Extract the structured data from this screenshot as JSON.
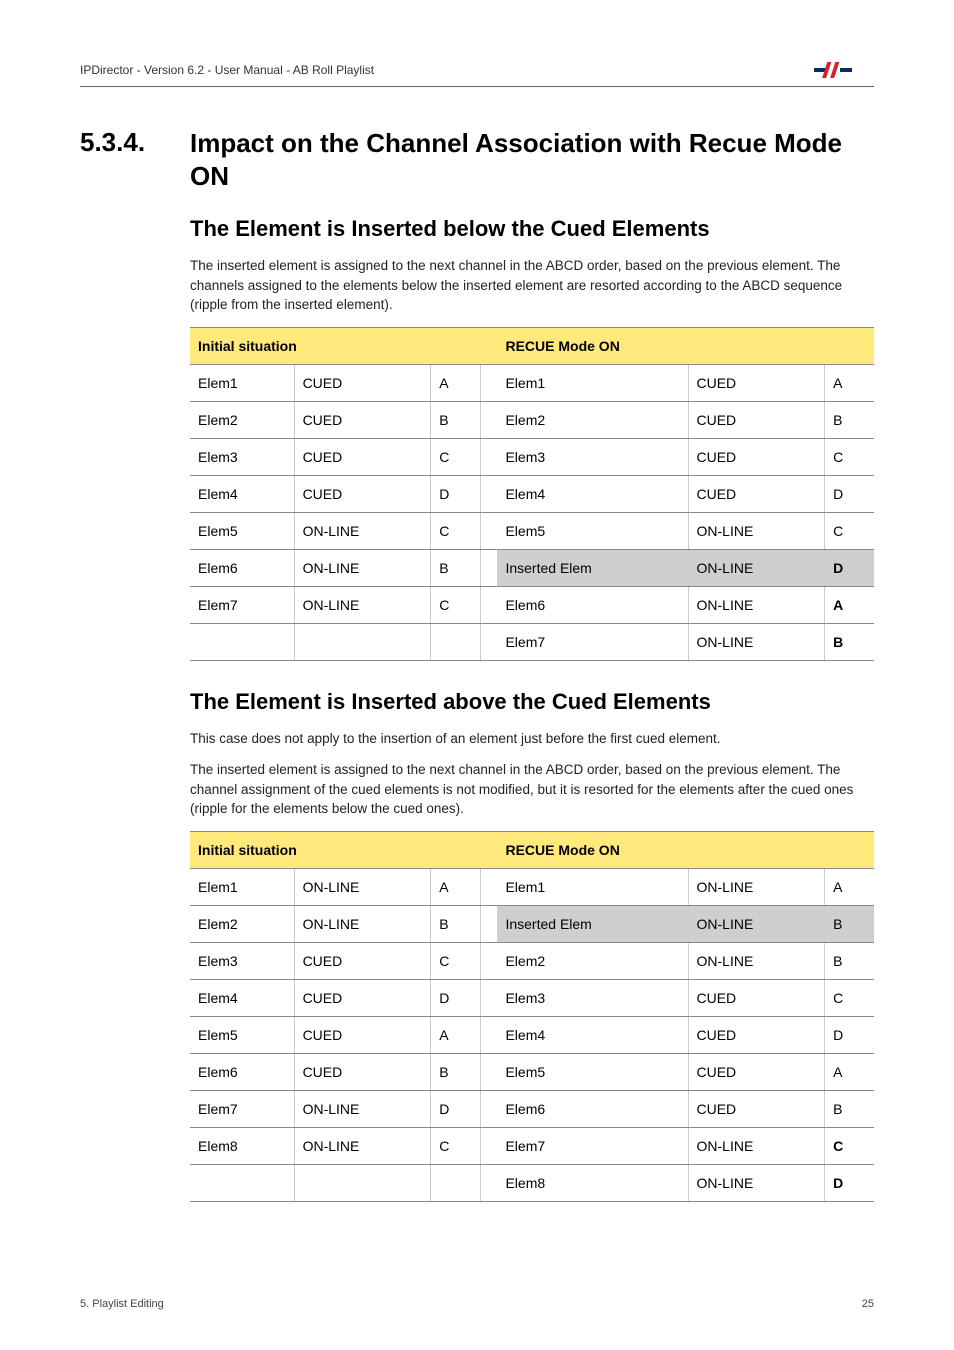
{
  "header": {
    "doc_title": "IPDirector - Version 6.2 - User Manual - AB Roll Playlist"
  },
  "section": {
    "number": "5.3.4.",
    "title": "Impact on the Channel Association with Recue Mode ON"
  },
  "sub1": {
    "heading": "The Element is Inserted below the Cued Elements",
    "para": "The inserted element is assigned to the next channel in the ABCD order, based on the previous element. The channels assigned to the elements below the inserted element are resorted according to the ABCD sequence (ripple from the inserted element).",
    "th_left": "Initial situation",
    "th_right": "RECUE Mode ON",
    "rows": [
      {
        "l": [
          "Elem1",
          "CUED",
          "A"
        ],
        "r": [
          "Elem1",
          "CUED",
          "A"
        ],
        "hl": false,
        "bold": false
      },
      {
        "l": [
          "Elem2",
          "CUED",
          "B"
        ],
        "r": [
          "Elem2",
          "CUED",
          "B"
        ],
        "hl": false,
        "bold": false
      },
      {
        "l": [
          "Elem3",
          "CUED",
          "C"
        ],
        "r": [
          "Elem3",
          "CUED",
          "C"
        ],
        "hl": false,
        "bold": false
      },
      {
        "l": [
          "Elem4",
          "CUED",
          "D"
        ],
        "r": [
          "Elem4",
          "CUED",
          "D"
        ],
        "hl": false,
        "bold": false
      },
      {
        "l": [
          "Elem5",
          "ON-LINE",
          "C"
        ],
        "r": [
          "Elem5",
          "ON-LINE",
          "C"
        ],
        "hl": false,
        "bold": false
      },
      {
        "l": [
          "Elem6",
          "ON-LINE",
          "B"
        ],
        "r": [
          "Inserted Elem",
          "ON-LINE",
          "D"
        ],
        "hl": true,
        "bold": true
      },
      {
        "l": [
          "Elem7",
          "ON-LINE",
          "C"
        ],
        "r": [
          "Elem6",
          "ON-LINE",
          "A"
        ],
        "hl": false,
        "bold": true
      },
      {
        "l": [
          "",
          "",
          ""
        ],
        "r": [
          "Elem7",
          "ON-LINE",
          "B"
        ],
        "hl": false,
        "bold": true
      }
    ]
  },
  "sub2": {
    "heading": "The Element is Inserted above the Cued Elements",
    "para1": "This case does not apply to the insertion of an element just before the first cued element.",
    "para2": "The inserted element is assigned to the next channel in the ABCD order, based on the previous element. The channel assignment of the cued elements is not modified, but it is resorted for the elements after the cued ones (ripple for the elements below the cued ones).",
    "th_left": "Initial situation",
    "th_right": "RECUE Mode ON",
    "rows": [
      {
        "l": [
          "Elem1",
          "ON-LINE",
          "A"
        ],
        "r": [
          "Elem1",
          "ON-LINE",
          "A"
        ],
        "hl": false,
        "bold": false
      },
      {
        "l": [
          "Elem2",
          "ON-LINE",
          "B"
        ],
        "r": [
          "Inserted Elem",
          "ON-LINE",
          "B"
        ],
        "hl": true,
        "bold": false
      },
      {
        "l": [
          "Elem3",
          "CUED",
          "C"
        ],
        "r": [
          "Elem2",
          "ON-LINE",
          "B"
        ],
        "hl": false,
        "bold": false
      },
      {
        "l": [
          "Elem4",
          "CUED",
          "D"
        ],
        "r": [
          "Elem3",
          "CUED",
          "C"
        ],
        "hl": false,
        "bold": false
      },
      {
        "l": [
          "Elem5",
          "CUED",
          "A"
        ],
        "r": [
          "Elem4",
          "CUED",
          "D"
        ],
        "hl": false,
        "bold": false
      },
      {
        "l": [
          "Elem6",
          "CUED",
          "B"
        ],
        "r": [
          "Elem5",
          "CUED",
          "A"
        ],
        "hl": false,
        "bold": false
      },
      {
        "l": [
          "Elem7",
          "ON-LINE",
          "D"
        ],
        "r": [
          "Elem6",
          "CUED",
          "B"
        ],
        "hl": false,
        "bold": false
      },
      {
        "l": [
          "Elem8",
          "ON-LINE",
          "C"
        ],
        "r": [
          "Elem7",
          "ON-LINE",
          "C"
        ],
        "hl": false,
        "bold": true
      },
      {
        "l": [
          "",
          "",
          ""
        ],
        "r": [
          "Elem8",
          "ON-LINE",
          "D"
        ],
        "hl": false,
        "bold": true
      }
    ]
  },
  "footer": {
    "left": "5. Playlist Editing",
    "right": "25"
  }
}
